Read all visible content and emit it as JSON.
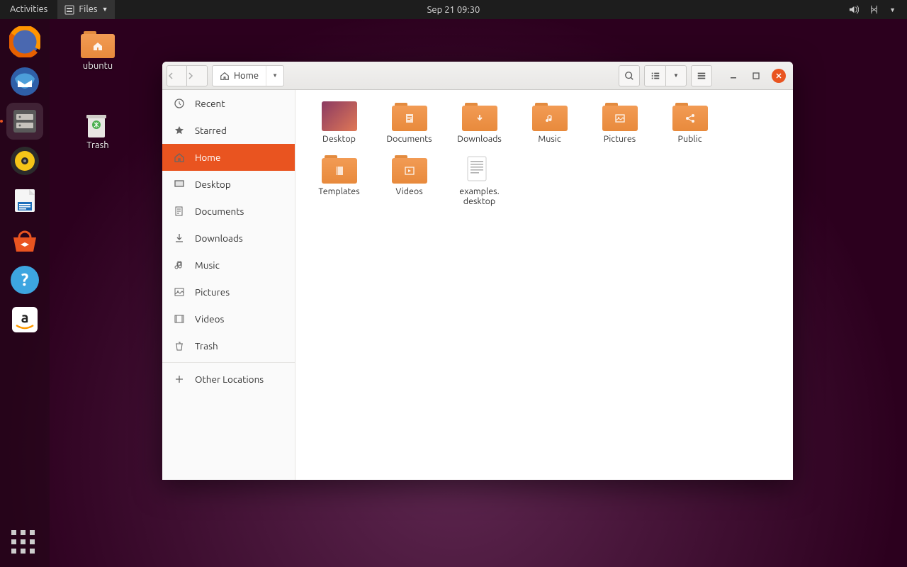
{
  "topbar": {
    "activities": "Activities",
    "app_name": "Files",
    "datetime": "Sep 21  09:30"
  },
  "desktop": {
    "home_folder": "ubuntu",
    "trash": "Trash"
  },
  "dock": {
    "items": [
      {
        "name": "firefox"
      },
      {
        "name": "thunderbird"
      },
      {
        "name": "files",
        "active": true
      },
      {
        "name": "rhythmbox"
      },
      {
        "name": "libreoffice-writer"
      },
      {
        "name": "ubuntu-software"
      },
      {
        "name": "help"
      },
      {
        "name": "amazon"
      }
    ]
  },
  "window": {
    "path_label": "Home",
    "sidebar": [
      {
        "label": "Recent",
        "icon": "clock"
      },
      {
        "label": "Starred",
        "icon": "star"
      },
      {
        "label": "Home",
        "icon": "home",
        "active": true
      },
      {
        "label": "Desktop",
        "icon": "desktop"
      },
      {
        "label": "Documents",
        "icon": "documents"
      },
      {
        "label": "Downloads",
        "icon": "downloads"
      },
      {
        "label": "Music",
        "icon": "music"
      },
      {
        "label": "Pictures",
        "icon": "pictures"
      },
      {
        "label": "Videos",
        "icon": "videos"
      },
      {
        "label": "Trash",
        "icon": "trash"
      }
    ],
    "other_locations": "Other Locations",
    "items": [
      {
        "label": "Desktop",
        "type": "desktop-gradient"
      },
      {
        "label": "Documents",
        "type": "folder",
        "glyph": "doc"
      },
      {
        "label": "Downloads",
        "type": "folder",
        "glyph": "down"
      },
      {
        "label": "Music",
        "type": "folder",
        "glyph": "music"
      },
      {
        "label": "Pictures",
        "type": "folder",
        "glyph": "pic"
      },
      {
        "label": "Public",
        "type": "folder",
        "glyph": "share"
      },
      {
        "label": "Templates",
        "type": "folder",
        "glyph": "temp"
      },
      {
        "label": "Videos",
        "type": "folder",
        "glyph": "video"
      },
      {
        "label": "examples.\ndesktop",
        "type": "textfile"
      }
    ]
  }
}
